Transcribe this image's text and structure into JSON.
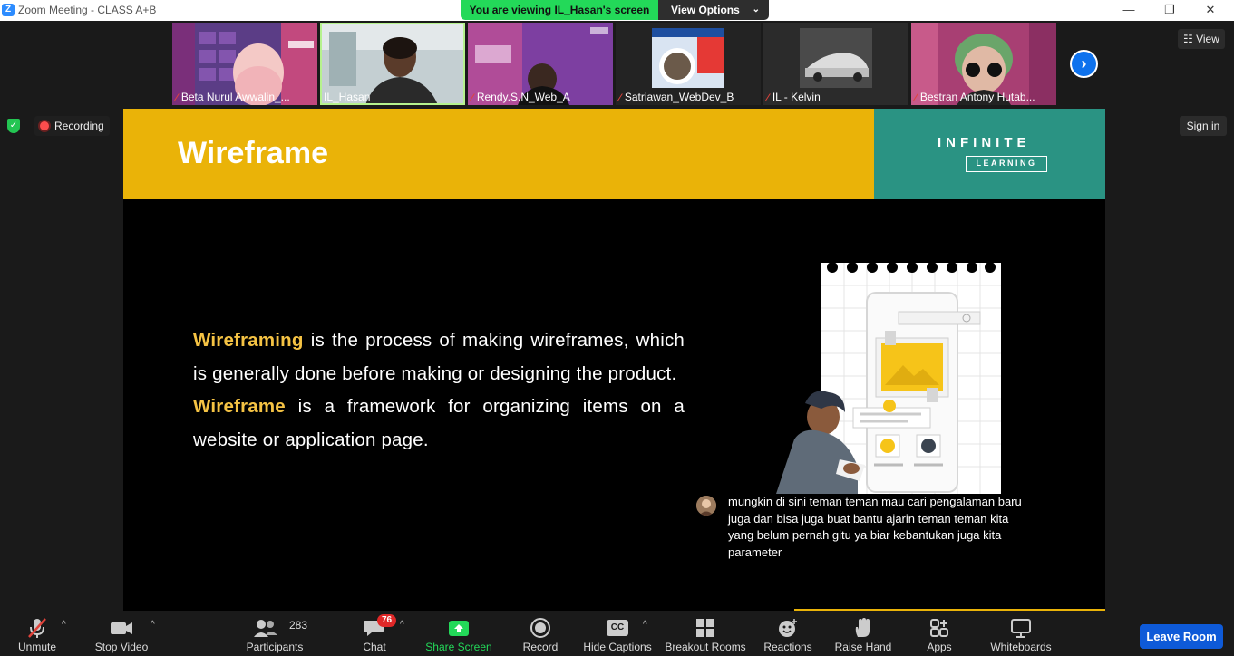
{
  "window": {
    "title": "Zoom Meeting - CLASS A+B",
    "app_icon": "Z",
    "minimize": "—",
    "restore": "❐",
    "close": "✕"
  },
  "viewing_bar": {
    "status": "You are viewing IL_Hasan's screen",
    "view_options": "View Options",
    "chevron": "⌄"
  },
  "participants_strip": [
    {
      "name": "Beta Nurul Awwalin_...",
      "muted": true,
      "mute_glyph": "⁄",
      "bg": "#6a3a8c"
    },
    {
      "name": "IL_Hasan",
      "muted": false,
      "mute_glyph": "",
      "bg": "#c9d4d6",
      "active": true
    },
    {
      "name": "Rendy.S.N_Web_A",
      "muted": true,
      "mute_glyph": "⁄",
      "bg": "#7b3f9e"
    },
    {
      "name": "Satriawan_WebDev_B",
      "muted": true,
      "mute_glyph": "⁄",
      "bg": "#2a2a2a"
    },
    {
      "name": "IL - Kelvin",
      "muted": true,
      "mute_glyph": "⁄",
      "bg": "#353535"
    },
    {
      "name": "Bestran Antony Hutab...",
      "muted": true,
      "mute_glyph": "⁄",
      "bg": "#b03a6a"
    }
  ],
  "strip_next": "›",
  "view_button": "☷ View",
  "signin_button": "Sign in",
  "recording": "Recording",
  "slide": {
    "title": "Wireframe",
    "logo_main": "INFINITE",
    "logo_sub": "LEARNING",
    "p1_term": "Wireframing",
    "p1_rest": " is the process of making wireframes, which is generally done before making or designing the product.",
    "p2_term": "Wireframe",
    "p2_rest": " is a framework for organizing items on a website or application page."
  },
  "chat_popup": {
    "message": "mungkin di sini teman teman mau cari pengalaman baru juga dan bisa juga buat bantu ajarin teman teman kita yang belum pernah gitu ya biar kebantukan juga kita parameter"
  },
  "toolbar": {
    "unmute": "Unmute",
    "stop_video": "Stop Video",
    "participants": "Participants",
    "participants_count": "283",
    "chat": "Chat",
    "chat_badge": "76",
    "share_screen": "Share Screen",
    "record": "Record",
    "hide_captions": "Hide Captions",
    "breakout_rooms": "Breakout Rooms",
    "reactions": "Reactions",
    "raise_hand": "Raise Hand",
    "apps": "Apps",
    "whiteboards": "Whiteboards",
    "leave_room": "Leave Room",
    "caret": "^",
    "cc": "CC"
  },
  "colors": {
    "accent_green": "#23d959",
    "slide_yellow": "#eab308",
    "logo_teal": "#2a9383",
    "highlight": "#f5c344",
    "leave_blue": "#0e5ad8"
  }
}
